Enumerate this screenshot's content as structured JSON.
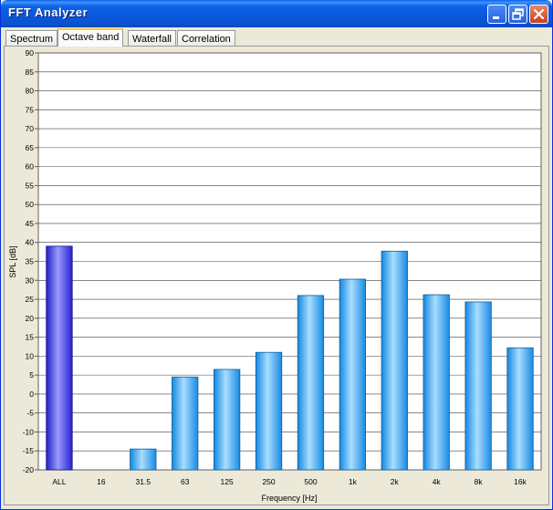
{
  "window": {
    "title": "FFT Analyzer"
  },
  "tabs": [
    {
      "label": "Spectrum",
      "active": false
    },
    {
      "label": "Octave band",
      "active": true
    },
    {
      "label": "Waterfall",
      "active": false
    },
    {
      "label": "Correlation",
      "active": false
    }
  ],
  "chart_data": {
    "type": "bar",
    "xlabel": "Frequency [Hz]",
    "ylabel": "SPL [dB]",
    "ylim": [
      -20,
      90
    ],
    "ytick_step": 5,
    "grid": true,
    "categories": [
      "ALL",
      "16",
      "31.5",
      "63",
      "125",
      "250",
      "500",
      "1k",
      "2k",
      "4k",
      "8k",
      "16k"
    ],
    "values": [
      39,
      -20,
      -14.5,
      4.5,
      6.5,
      11,
      26,
      30.3,
      37.7,
      26.2,
      24.3,
      12.2
    ],
    "colors": {
      "all": "#3535E8",
      "bands": "#2FA7F0",
      "grid": "#404040"
    }
  }
}
